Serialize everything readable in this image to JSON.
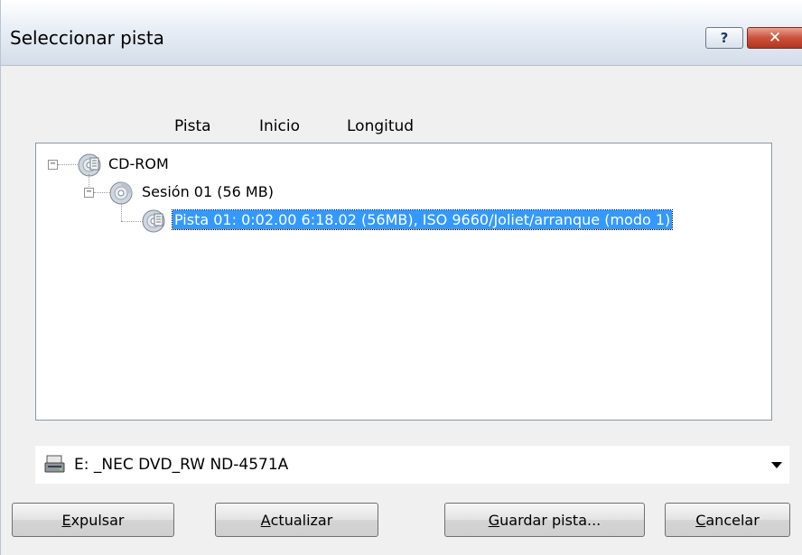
{
  "window": {
    "title": "Seleccionar pista",
    "help_label": "?",
    "close_label": "✕"
  },
  "columns": [
    "Pista",
    "Inicio",
    "Longitud"
  ],
  "tree": {
    "root_label": "CD-ROM",
    "root_expander": "−",
    "session_label": "Sesión 01 (56 MB)",
    "session_expander": "−",
    "track_label": "Pista 01: 0:02.00 6:18.02 (56MB), ISO 9660/Joliet/arranque (modo 1)"
  },
  "drive": {
    "selected_value": "E: _NEC DVD_RW ND-4571A",
    "icon": "drive-icon"
  },
  "buttons": {
    "eject_first": "E",
    "eject_rest": "xpulsar",
    "refresh_first": "A",
    "refresh_rest": "ctualizar",
    "save_first": "G",
    "save_rest": "uardar pista...",
    "cancel_first": "C",
    "cancel_rest": "ancelar"
  },
  "colors": {
    "selection": "#3399ff",
    "title_bar": "#dbe4ef",
    "close_button": "#c8523c"
  }
}
